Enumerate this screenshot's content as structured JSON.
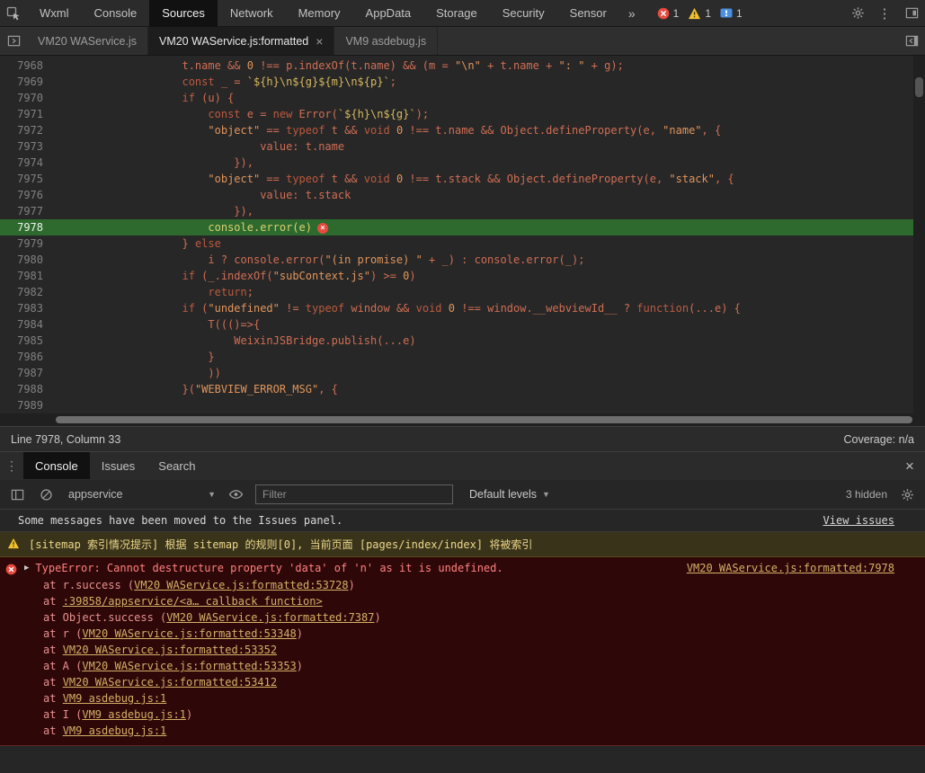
{
  "icons": {
    "caret_down": "▼",
    "kebab": "⋮",
    "close": "×",
    "chevron_double": "»",
    "expand_arrow": "▶"
  },
  "colors": {
    "highlight_line_green": "#2e6a2e",
    "error_row_bg": "#2e0808",
    "warning_row_bg": "#39331a",
    "link_gold": "#d6af67",
    "error_text": "#ff8080",
    "error_badge_red": "#e8493f",
    "warning_yellow": "#f2c12e",
    "issue_blue": "#4a8fe2"
  },
  "top_toolbar": {
    "tabs": [
      {
        "label": "Wxml"
      },
      {
        "label": "Console"
      },
      {
        "label": "Sources",
        "active": true
      },
      {
        "label": "Network"
      },
      {
        "label": "Memory"
      },
      {
        "label": "AppData"
      },
      {
        "label": "Storage"
      },
      {
        "label": "Security"
      },
      {
        "label": "Sensor"
      }
    ],
    "badges": [
      {
        "type": "error",
        "count": "1"
      },
      {
        "type": "warning",
        "count": "1"
      },
      {
        "type": "issue",
        "count": "1"
      }
    ]
  },
  "file_tab_bar": {
    "tabs": [
      {
        "label": "VM20 WAService.js"
      },
      {
        "label": "VM20 WAService.js:formatted",
        "active": true,
        "closable": true
      },
      {
        "label": "VM9 asdebug.js"
      }
    ]
  },
  "editor": {
    "lines": [
      {
        "no": "7968",
        "indent": 20,
        "tokens": [
          [
            "d",
            "t.name && "
          ],
          [
            "n",
            "0"
          ],
          [
            "d",
            " !== p.indexOf(t.name) && (m = "
          ],
          [
            "s",
            "\"\\n\""
          ],
          [
            "d",
            " + t.name + "
          ],
          [
            "s",
            "\": \""
          ],
          [
            "d",
            " + g);"
          ]
        ]
      },
      {
        "no": "7969",
        "indent": 20,
        "tokens": [
          [
            "k",
            "const"
          ],
          [
            "d",
            " _ = "
          ],
          [
            "t",
            "`${h}\\n${g}${m}\\n${p}`"
          ],
          [
            "d",
            ";"
          ]
        ]
      },
      {
        "no": "7970",
        "indent": 20,
        "tokens": [
          [
            "k",
            "if"
          ],
          [
            "d",
            " (u) {"
          ]
        ]
      },
      {
        "no": "7971",
        "indent": 24,
        "tokens": [
          [
            "k",
            "const"
          ],
          [
            "d",
            " e = "
          ],
          [
            "k",
            "new"
          ],
          [
            "d",
            " Error("
          ],
          [
            "t",
            "`${h}\\n${g}`"
          ],
          [
            "d",
            ");"
          ]
        ]
      },
      {
        "no": "7972",
        "indent": 24,
        "tokens": [
          [
            "s",
            "\"object\""
          ],
          [
            "d",
            " == "
          ],
          [
            "k",
            "typeof"
          ],
          [
            "d",
            " t && "
          ],
          [
            "k",
            "void"
          ],
          [
            "d",
            " "
          ],
          [
            "n",
            "0"
          ],
          [
            "d",
            " !== t.name && Object.defineProperty(e, "
          ],
          [
            "s",
            "\"name\""
          ],
          [
            "d",
            ", {"
          ]
        ]
      },
      {
        "no": "7973",
        "indent": 32,
        "tokens": [
          [
            "d",
            "value: t.name"
          ]
        ]
      },
      {
        "no": "7974",
        "indent": 28,
        "tokens": [
          [
            "d",
            "}),"
          ]
        ]
      },
      {
        "no": "7975",
        "indent": 24,
        "tokens": [
          [
            "s",
            "\"object\""
          ],
          [
            "d",
            " == "
          ],
          [
            "k",
            "typeof"
          ],
          [
            "d",
            " t && "
          ],
          [
            "k",
            "void"
          ],
          [
            "d",
            " "
          ],
          [
            "n",
            "0"
          ],
          [
            "d",
            " !== t.stack && Object.defineProperty(e, "
          ],
          [
            "s",
            "\"stack\""
          ],
          [
            "d",
            ", {"
          ]
        ]
      },
      {
        "no": "7976",
        "indent": 32,
        "tokens": [
          [
            "d",
            "value: t.stack"
          ]
        ]
      },
      {
        "no": "7977",
        "indent": 28,
        "tokens": [
          [
            "d",
            "}),"
          ]
        ]
      },
      {
        "no": "7978",
        "indent": 24,
        "tokens": [
          [
            "hl",
            "console.error(e)"
          ]
        ],
        "highlight": true,
        "badge": true
      },
      {
        "no": "7979",
        "indent": 20,
        "tokens": [
          [
            "d",
            "} "
          ],
          [
            "k",
            "else"
          ]
        ]
      },
      {
        "no": "7980",
        "indent": 24,
        "tokens": [
          [
            "d",
            "i ? console.error("
          ],
          [
            "s",
            "\"(in promise) \""
          ],
          [
            "d",
            " + _) : console.error(_);"
          ]
        ]
      },
      {
        "no": "7981",
        "indent": 20,
        "tokens": [
          [
            "k",
            "if"
          ],
          [
            "d",
            " (_.indexOf("
          ],
          [
            "s",
            "\"subContext.js\""
          ],
          [
            "d",
            ") >= "
          ],
          [
            "n",
            "0"
          ],
          [
            "d",
            ")"
          ]
        ]
      },
      {
        "no": "7982",
        "indent": 24,
        "tokens": [
          [
            "k",
            "return"
          ],
          [
            "d",
            ";"
          ]
        ]
      },
      {
        "no": "7983",
        "indent": 20,
        "tokens": [
          [
            "k",
            "if"
          ],
          [
            "d",
            " ("
          ],
          [
            "s",
            "\"undefined\""
          ],
          [
            "d",
            " != "
          ],
          [
            "k",
            "typeof"
          ],
          [
            "d",
            " window && "
          ],
          [
            "k",
            "void"
          ],
          [
            "d",
            " "
          ],
          [
            "n",
            "0"
          ],
          [
            "d",
            " !== window.__webviewId__ ? "
          ],
          [
            "k",
            "function"
          ],
          [
            "d",
            "(...e) {"
          ]
        ]
      },
      {
        "no": "7984",
        "indent": 24,
        "tokens": [
          [
            "d",
            "T((()=>{"
          ]
        ]
      },
      {
        "no": "7985",
        "indent": 28,
        "tokens": [
          [
            "d",
            "WeixinJSBridge.publish(...e)"
          ]
        ]
      },
      {
        "no": "7986",
        "indent": 24,
        "tokens": [
          [
            "d",
            "}"
          ]
        ]
      },
      {
        "no": "7987",
        "indent": 24,
        "tokens": [
          [
            "d",
            "))"
          ]
        ]
      },
      {
        "no": "7988",
        "indent": 20,
        "tokens": [
          [
            "d",
            "}("
          ],
          [
            "s",
            "\"WEBVIEW_ERROR_MSG\""
          ],
          [
            "d",
            ", {"
          ]
        ]
      },
      {
        "no": "7989",
        "indent": 24,
        "tokens": []
      }
    ]
  },
  "status_bar": {
    "position": "Line 7978, Column 33",
    "coverage": "Coverage: n/a"
  },
  "drawer": {
    "tabs": [
      {
        "label": "Console",
        "active": true
      },
      {
        "label": "Issues"
      },
      {
        "label": "Search"
      }
    ],
    "toolbar": {
      "context": "appservice",
      "filter_placeholder": "Filter",
      "levels": "Default levels",
      "hidden_count": "3 hidden"
    },
    "messages": {
      "info": {
        "text": "Some messages have been moved to the Issues panel.",
        "link": "View issues"
      },
      "warning": {
        "text": "[sitemap 索引情况提示] 根据 sitemap 的规则[0], 当前页面 [pages/index/index] 将被索引"
      },
      "error": {
        "message": "TypeError: Cannot destructure property 'data' of 'n' as it is undefined.",
        "source_link": "VM20 WAService.js:formatted:7978",
        "stack": [
          {
            "pre": "at r.success (",
            "link": "VM20 WAService.js:formatted:53728",
            "post": ")"
          },
          {
            "pre": "at ",
            "link": ":39858/appservice/<a… callback function>",
            "post": ""
          },
          {
            "pre": "at Object.success (",
            "link": "VM20 WAService.js:formatted:7387",
            "post": ")"
          },
          {
            "pre": "at r (",
            "link": "VM20 WAService.js:formatted:53348",
            "post": ")"
          },
          {
            "pre": "at ",
            "link": "VM20 WAService.js:formatted:53352",
            "post": ""
          },
          {
            "pre": "at A (",
            "link": "VM20 WAService.js:formatted:53353",
            "post": ")"
          },
          {
            "pre": "at ",
            "link": "VM20 WAService.js:formatted:53412",
            "post": ""
          },
          {
            "pre": "at ",
            "link": "VM9 asdebug.js:1",
            "post": ""
          },
          {
            "pre": "at I (",
            "link": "VM9 asdebug.js:1",
            "post": ")"
          },
          {
            "pre": "at ",
            "link": "VM9 asdebug.js:1",
            "post": ""
          }
        ]
      }
    }
  }
}
